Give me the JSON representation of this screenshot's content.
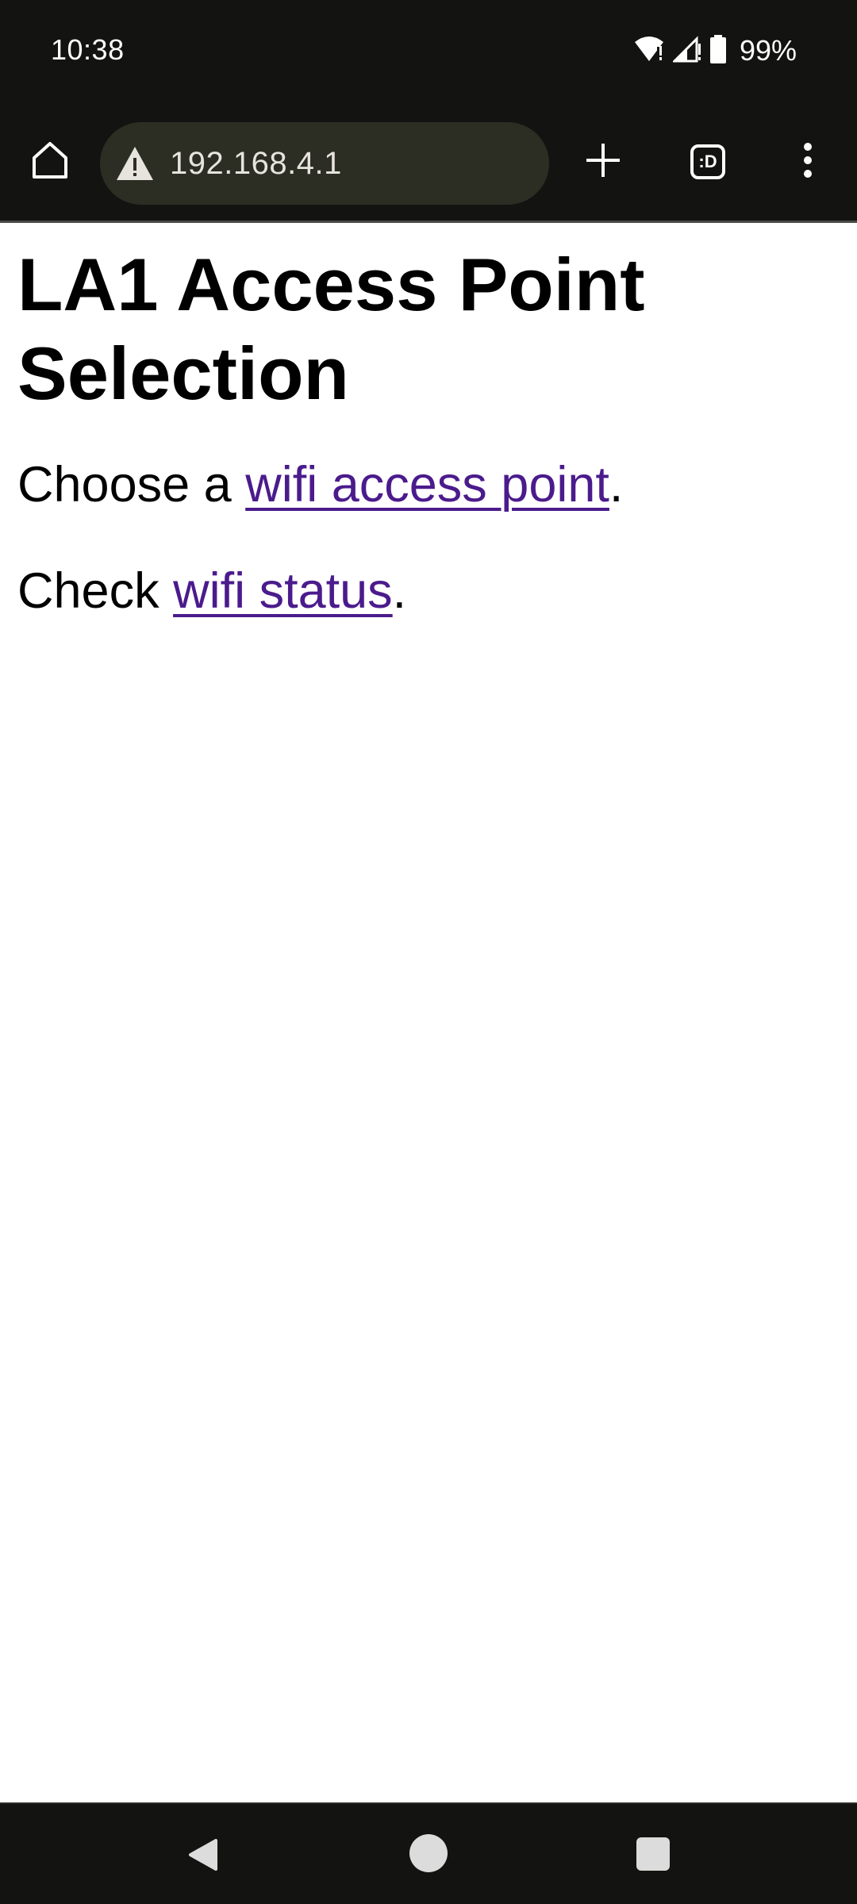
{
  "status_bar": {
    "time": "10:38",
    "battery": "99%",
    "icons": [
      "wifi-icon",
      "signal-icon",
      "battery-icon"
    ]
  },
  "browser": {
    "url": "192.168.4.1",
    "tab_switcher_label": ":D",
    "icons": [
      "home-icon",
      "warning-icon",
      "plus-icon",
      "tab-switcher-icon",
      "more-vert-icon"
    ]
  },
  "page": {
    "heading": "LA1 Access Point Selection",
    "para1": {
      "prefix": "Choose a ",
      "link": "wifi access point",
      "suffix": "."
    },
    "para2": {
      "prefix": "Check ",
      "link": "wifi status",
      "suffix": "."
    }
  },
  "colors": {
    "chrome_background": "#131411",
    "url_bar_background": "#2c2e24",
    "visited_link": "#4b1b8c"
  },
  "nav_bar": {
    "icons": [
      "back-icon",
      "home-circle-icon",
      "recents-icon"
    ]
  }
}
